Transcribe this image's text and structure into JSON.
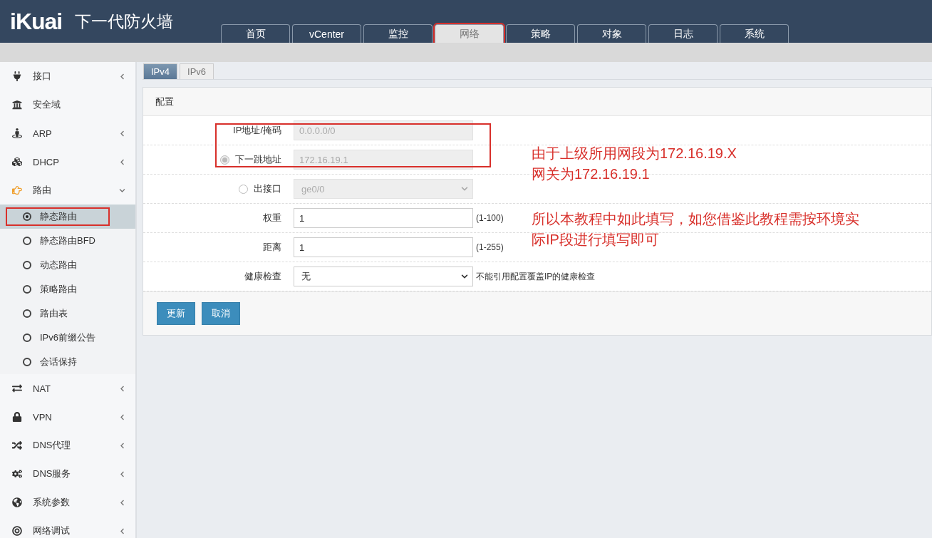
{
  "header": {
    "logo": "iKuai",
    "title": "下一代防火墙"
  },
  "nav_tabs": [
    {
      "label": "首页",
      "selected": false,
      "annotated": false
    },
    {
      "label": "vCenter",
      "selected": false,
      "annotated": false
    },
    {
      "label": "监控",
      "selected": false,
      "annotated": false
    },
    {
      "label": "网络",
      "selected": true,
      "annotated": true
    },
    {
      "label": "策略",
      "selected": false,
      "annotated": false
    },
    {
      "label": "对象",
      "selected": false,
      "annotated": false
    },
    {
      "label": "日志",
      "selected": false,
      "annotated": false
    },
    {
      "label": "系统",
      "selected": false,
      "annotated": false
    }
  ],
  "sidebar": {
    "items": [
      {
        "label": "接口",
        "expanded": false
      },
      {
        "label": "安全域"
      },
      {
        "label": "ARP",
        "expanded": false
      },
      {
        "label": "DHCP",
        "expanded": false
      },
      {
        "label": "路由",
        "expanded": true,
        "children": [
          {
            "label": "静态路由",
            "selected": true,
            "annotated": true
          },
          {
            "label": "静态路由BFD",
            "selected": false,
            "annotated": false
          },
          {
            "label": "动态路由",
            "selected": false,
            "annotated": false
          },
          {
            "label": "策略路由",
            "selected": false,
            "annotated": false
          },
          {
            "label": "路由表",
            "selected": false,
            "annotated": false
          },
          {
            "label": "IPv6前缀公告",
            "selected": false,
            "annotated": false
          },
          {
            "label": "会话保持",
            "selected": false,
            "annotated": false
          }
        ]
      },
      {
        "label": "NAT",
        "expanded": false
      },
      {
        "label": "VPN",
        "expanded": false
      },
      {
        "label": "DNS代理",
        "expanded": false
      },
      {
        "label": "DNS服务",
        "expanded": false
      },
      {
        "label": "系统参数",
        "expanded": false
      },
      {
        "label": "网络调试",
        "expanded": false
      }
    ]
  },
  "sub_tabs": [
    {
      "label": "IPv4",
      "selected": true
    },
    {
      "label": "IPv6",
      "selected": false
    }
  ],
  "form": {
    "title": "配置",
    "annotate_first_rows": true,
    "rows": [
      {
        "kind": "text",
        "label": "IP地址/掩码",
        "value": "0.0.0.0/0",
        "disabled": true
      },
      {
        "kind": "text",
        "label": "下一跳地址",
        "value": "172.16.19.1",
        "disabled": true,
        "radio": {
          "checked": true,
          "disabled": true
        }
      },
      {
        "kind": "select",
        "label": "出接口",
        "value": "ge0/0",
        "disabled": true,
        "radio": {
          "checked": false,
          "disabled": false
        }
      },
      {
        "kind": "text",
        "label": "权重",
        "value": "1",
        "disabled": false,
        "hint": "(1-100)"
      },
      {
        "kind": "text",
        "label": "距离",
        "value": "1",
        "disabled": false,
        "hint": "(1-255)"
      },
      {
        "kind": "select",
        "label": "健康检查",
        "value": "无",
        "disabled": false,
        "hint": "不能引用配置覆盖IP的健康检查"
      }
    ],
    "buttons": [
      "更新",
      "取消"
    ]
  },
  "annotations": [
    {
      "lines": [
        "由于上级所用网段为172.16.19.X",
        "网关为172.16.19.1"
      ]
    },
    {
      "lines": [
        "所以本教程中如此填写，如您借鉴此教程需按环境实",
        "际IP段进行填写即可"
      ]
    }
  ]
}
